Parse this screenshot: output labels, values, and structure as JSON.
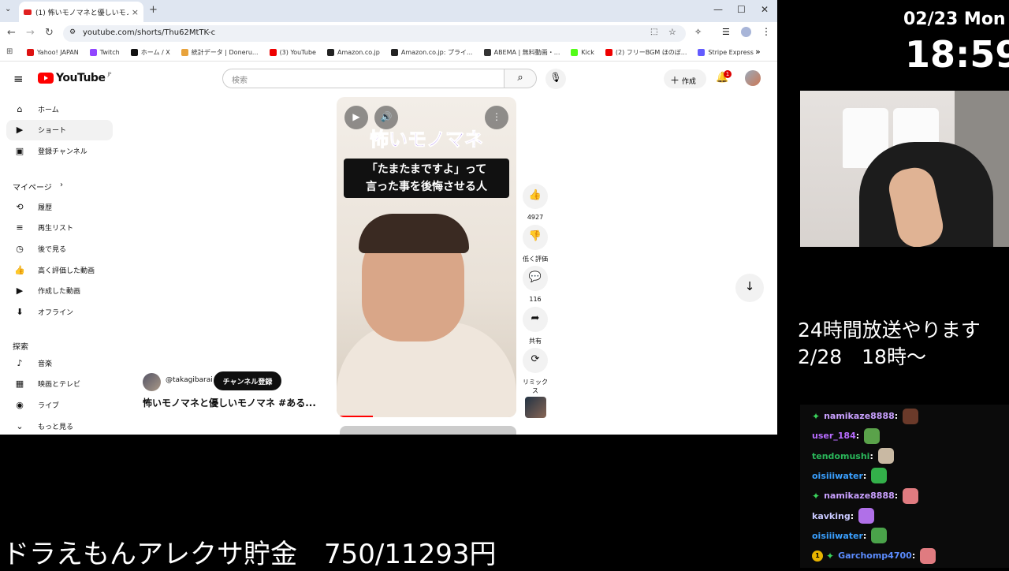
{
  "browser": {
    "tab_title": "(1) 怖いモノマネと優しいモノマネ #ある...",
    "url": "youtube.com/shorts/Thu62MtTK-c",
    "bookmarks": [
      {
        "label": "Yahoo! JAPAN",
        "color": "#d11"
      },
      {
        "label": "Twitch",
        "color": "#9146ff"
      },
      {
        "label": "ホーム / X",
        "color": "#111"
      },
      {
        "label": "統計データ | Doneru...",
        "color": "#e8a33c"
      },
      {
        "label": "(3) YouTube",
        "color": "#e00"
      },
      {
        "label": "Amazon.co.jp",
        "color": "#222"
      },
      {
        "label": "Amazon.co.jp: プライ...",
        "color": "#222"
      },
      {
        "label": "ABEMA | 無料動画・...",
        "color": "#333"
      },
      {
        "label": "Kick",
        "color": "#53fc18"
      },
      {
        "label": "(2) フリーBGM ほのぼ...",
        "color": "#e00"
      },
      {
        "label": "Stripe Express",
        "color": "#635bff"
      }
    ]
  },
  "youtube": {
    "logo": "YouTube",
    "logo_region": "JP",
    "search_placeholder": "検索",
    "create_label": "作成",
    "notif_count": "1",
    "sidebar_top": [
      {
        "label": "ホーム",
        "icon": "⌂"
      },
      {
        "label": "ショート",
        "icon": "▶"
      },
      {
        "label": "登録チャンネル",
        "icon": "▣"
      }
    ],
    "my_page": "マイページ",
    "sidebar_my": [
      {
        "label": "履歴",
        "icon": "⟲"
      },
      {
        "label": "再生リスト",
        "icon": "≡"
      },
      {
        "label": "後で見る",
        "icon": "◷"
      },
      {
        "label": "高く評価した動画",
        "icon": "👍"
      },
      {
        "label": "作成した動画",
        "icon": "▶"
      },
      {
        "label": "オフライン",
        "icon": "⬇"
      }
    ],
    "explore": "探索",
    "sidebar_explore": [
      {
        "label": "音楽",
        "icon": "♪"
      },
      {
        "label": "映画とテレビ",
        "icon": "▦"
      },
      {
        "label": "ライブ",
        "icon": "◉"
      },
      {
        "label": "もっと見る",
        "icon": "⌄"
      }
    ],
    "short": {
      "title_overlay": "怖いモノマネ",
      "caption_line1": "「たまたまですよ」って",
      "caption_line2": "言った事を後悔させる人",
      "channel": "@takagibarai",
      "subscribe": "チャンネル登録",
      "video_title": "怖いモノマネと優しいモノマネ #ある...",
      "progress": 0.2
    },
    "actions": [
      {
        "icon": "👍",
        "label": "4927"
      },
      {
        "icon": "👎",
        "label": "低く評価"
      },
      {
        "icon": "💬",
        "label": "116"
      },
      {
        "icon": "➦",
        "label": "共有"
      },
      {
        "icon": "⟳",
        "label": "リミックス"
      }
    ]
  },
  "overlay": {
    "date": "02/23 Mon",
    "time": "18:59",
    "announce_line1": "24時間放送やります",
    "announce_line2": "2/28　18時～",
    "saving": "ドラえもんアレクサ貯金　750/11293円",
    "chat": [
      {
        "user": "namikaze8888",
        "color": "#c9a0ff",
        "star": true,
        "badge": "",
        "emote": "#6b3a2a"
      },
      {
        "user": "user_184",
        "color": "#b86cff",
        "star": false,
        "badge": "",
        "emote": "#5aa24a"
      },
      {
        "user": "tendomushi",
        "color": "#2ab75a",
        "star": false,
        "badge": "",
        "emote": "#c9b9a3"
      },
      {
        "user": "oisiiiwater",
        "color": "#3aa0ff",
        "star": false,
        "badge": "",
        "emote": "#33b04a"
      },
      {
        "user": "namikaze8888",
        "color": "#c9a0ff",
        "star": true,
        "badge": "",
        "emote": "#e07b80"
      },
      {
        "user": "kavking",
        "color": "#c9c9ff",
        "star": false,
        "badge": "",
        "emote": "#b070e8"
      },
      {
        "user": "oisiiiwater",
        "color": "#3aa0ff",
        "star": false,
        "badge": "",
        "emote": "#4aa24a"
      },
      {
        "user": "Garchomp4700",
        "color": "#5b8cff",
        "star": true,
        "badge": "1",
        "emote": "#e07b80"
      }
    ]
  }
}
